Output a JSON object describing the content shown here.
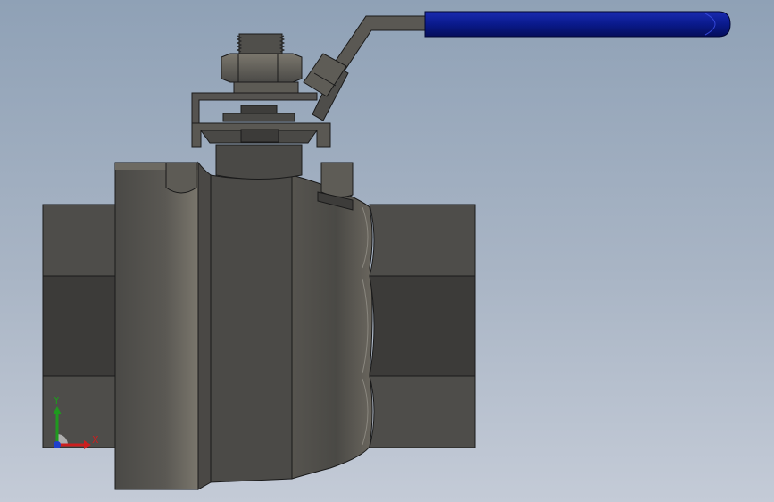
{
  "colors": {
    "background_top": "#8fa1b6",
    "background_bottom": "#c4cbd7",
    "body_metal": "#4b4a47",
    "body_metal_light": "#7b7870",
    "handle_grip": "#0a1a8c",
    "outline": "#1a1a1a",
    "axis_x": "#cc1f1f",
    "axis_y": "#1f9a1f",
    "axis_z": "#1f3fcc"
  },
  "triad": {
    "x_label": "X",
    "y_label": "Y",
    "icon": "reference-triad-icon"
  }
}
